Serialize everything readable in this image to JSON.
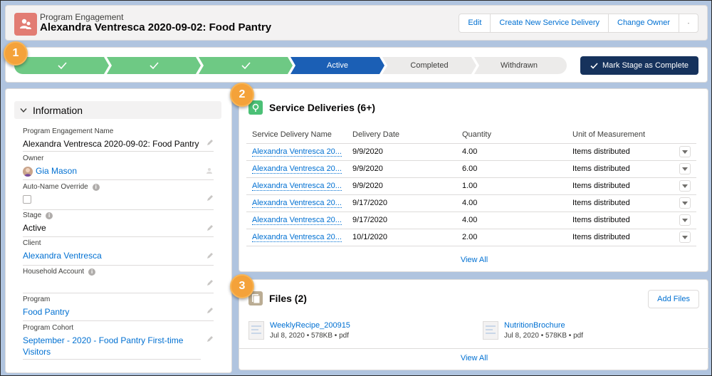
{
  "header": {
    "object_type": "Program Engagement",
    "title": "Alexandra Ventresca 2020-09-02: Food Pantry",
    "buttons": [
      "Edit",
      "Create New Service Delivery",
      "Change Owner"
    ]
  },
  "path": {
    "stages": [
      {
        "label": "",
        "status": "complete"
      },
      {
        "label": "",
        "status": "complete"
      },
      {
        "label": "",
        "status": "complete"
      },
      {
        "label": "Active",
        "status": "current"
      },
      {
        "label": "Completed",
        "status": "incomplete"
      },
      {
        "label": "Withdrawn",
        "status": "incomplete"
      }
    ],
    "mark_button": "Mark Stage as Complete"
  },
  "badges": [
    "1",
    "2",
    "3"
  ],
  "info": {
    "section_title": "Information",
    "fields": [
      {
        "label": "Program Engagement Name",
        "value": "Alexandra Ventresca 2020-09-02: Food Pantry"
      },
      {
        "label": "Owner",
        "value": "Gia Mason"
      },
      {
        "label": "Auto-Name Override",
        "value": ""
      },
      {
        "label": "Stage",
        "value": "Active"
      },
      {
        "label": "Client",
        "value": "Alexandra Ventresca"
      },
      {
        "label": "Household Account",
        "value": ""
      },
      {
        "label": "Program",
        "value": "Food Pantry"
      },
      {
        "label": "Program Cohort",
        "value": "September - 2020 - Food Pantry First-time Visitors"
      }
    ]
  },
  "service_deliveries": {
    "title": "Service Deliveries (6+)",
    "columns": [
      "Service Delivery Name",
      "Delivery Date",
      "Quantity",
      "Unit of Measurement"
    ],
    "rows": [
      [
        "Alexandra Ventresca 20...",
        "9/9/2020",
        "4.00",
        "Items distributed"
      ],
      [
        "Alexandra Ventresca 20...",
        "9/9/2020",
        "6.00",
        "Items distributed"
      ],
      [
        "Alexandra Ventresca 20...",
        "9/9/2020",
        "1.00",
        "Items distributed"
      ],
      [
        "Alexandra Ventresca 20...",
        "9/17/2020",
        "4.00",
        "Items distributed"
      ],
      [
        "Alexandra Ventresca 20...",
        "9/17/2020",
        "4.00",
        "Items distributed"
      ],
      [
        "Alexandra Ventresca 20...",
        "10/1/2020",
        "2.00",
        "Items distributed"
      ]
    ],
    "view_all": "View All"
  },
  "files": {
    "title": "Files (2)",
    "add_button": "Add Files",
    "items": [
      {
        "name": "WeeklyRecipe_200915",
        "meta": "Jul 8, 2020 • 578KB • pdf"
      },
      {
        "name": "NutritionBrochure",
        "meta": "Jul 8, 2020 • 578KB • pdf"
      }
    ],
    "view_all": "View All"
  },
  "colors": {
    "background": "#b0c4df",
    "path_complete": "#6ec984",
    "path_current": "#1b5fb5",
    "path_incomplete": "#ecebea",
    "badge": "#f4a23a",
    "link": "#0070d2",
    "object_icon": "#e27c73"
  }
}
